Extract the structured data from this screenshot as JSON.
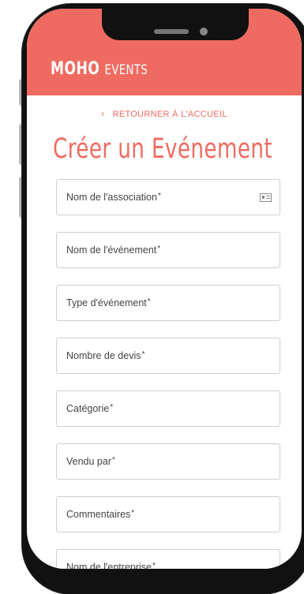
{
  "brand": {
    "logo_mark": "MOHO",
    "logo_text": "EVENTS",
    "accent": "#ef6b61"
  },
  "nav": {
    "back_label": "RETOURNER À L'ACCUEIL",
    "back_icon": "chevron-left-icon"
  },
  "page": {
    "title": "Créer un Evénement"
  },
  "form": {
    "required_mark": "*",
    "fields": [
      {
        "label": "Nom de l'association",
        "icon": "contact-card-icon"
      },
      {
        "label": "Nom de l'événement"
      },
      {
        "label": "Type d'événement"
      },
      {
        "label": "Nombre de devis"
      },
      {
        "label": "Catégorie"
      },
      {
        "label": "Vendu par"
      },
      {
        "label": "Commentaires"
      },
      {
        "label": "Nom de l'entreprise"
      }
    ]
  }
}
